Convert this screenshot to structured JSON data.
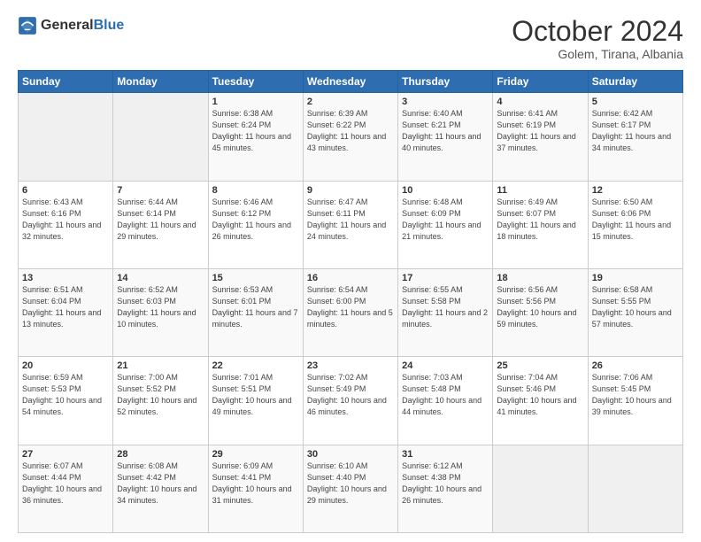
{
  "header": {
    "logo_general": "General",
    "logo_blue": "Blue",
    "month_year": "October 2024",
    "location": "Golem, Tirana, Albania"
  },
  "weekdays": [
    "Sunday",
    "Monday",
    "Tuesday",
    "Wednesday",
    "Thursday",
    "Friday",
    "Saturday"
  ],
  "weeks": [
    [
      {
        "day": "",
        "info": ""
      },
      {
        "day": "",
        "info": ""
      },
      {
        "day": "1",
        "info": "Sunrise: 6:38 AM\nSunset: 6:24 PM\nDaylight: 11 hours and 45 minutes."
      },
      {
        "day": "2",
        "info": "Sunrise: 6:39 AM\nSunset: 6:22 PM\nDaylight: 11 hours and 43 minutes."
      },
      {
        "day": "3",
        "info": "Sunrise: 6:40 AM\nSunset: 6:21 PM\nDaylight: 11 hours and 40 minutes."
      },
      {
        "day": "4",
        "info": "Sunrise: 6:41 AM\nSunset: 6:19 PM\nDaylight: 11 hours and 37 minutes."
      },
      {
        "day": "5",
        "info": "Sunrise: 6:42 AM\nSunset: 6:17 PM\nDaylight: 11 hours and 34 minutes."
      }
    ],
    [
      {
        "day": "6",
        "info": "Sunrise: 6:43 AM\nSunset: 6:16 PM\nDaylight: 11 hours and 32 minutes."
      },
      {
        "day": "7",
        "info": "Sunrise: 6:44 AM\nSunset: 6:14 PM\nDaylight: 11 hours and 29 minutes."
      },
      {
        "day": "8",
        "info": "Sunrise: 6:46 AM\nSunset: 6:12 PM\nDaylight: 11 hours and 26 minutes."
      },
      {
        "day": "9",
        "info": "Sunrise: 6:47 AM\nSunset: 6:11 PM\nDaylight: 11 hours and 24 minutes."
      },
      {
        "day": "10",
        "info": "Sunrise: 6:48 AM\nSunset: 6:09 PM\nDaylight: 11 hours and 21 minutes."
      },
      {
        "day": "11",
        "info": "Sunrise: 6:49 AM\nSunset: 6:07 PM\nDaylight: 11 hours and 18 minutes."
      },
      {
        "day": "12",
        "info": "Sunrise: 6:50 AM\nSunset: 6:06 PM\nDaylight: 11 hours and 15 minutes."
      }
    ],
    [
      {
        "day": "13",
        "info": "Sunrise: 6:51 AM\nSunset: 6:04 PM\nDaylight: 11 hours and 13 minutes."
      },
      {
        "day": "14",
        "info": "Sunrise: 6:52 AM\nSunset: 6:03 PM\nDaylight: 11 hours and 10 minutes."
      },
      {
        "day": "15",
        "info": "Sunrise: 6:53 AM\nSunset: 6:01 PM\nDaylight: 11 hours and 7 minutes."
      },
      {
        "day": "16",
        "info": "Sunrise: 6:54 AM\nSunset: 6:00 PM\nDaylight: 11 hours and 5 minutes."
      },
      {
        "day": "17",
        "info": "Sunrise: 6:55 AM\nSunset: 5:58 PM\nDaylight: 11 hours and 2 minutes."
      },
      {
        "day": "18",
        "info": "Sunrise: 6:56 AM\nSunset: 5:56 PM\nDaylight: 10 hours and 59 minutes."
      },
      {
        "day": "19",
        "info": "Sunrise: 6:58 AM\nSunset: 5:55 PM\nDaylight: 10 hours and 57 minutes."
      }
    ],
    [
      {
        "day": "20",
        "info": "Sunrise: 6:59 AM\nSunset: 5:53 PM\nDaylight: 10 hours and 54 minutes."
      },
      {
        "day": "21",
        "info": "Sunrise: 7:00 AM\nSunset: 5:52 PM\nDaylight: 10 hours and 52 minutes."
      },
      {
        "day": "22",
        "info": "Sunrise: 7:01 AM\nSunset: 5:51 PM\nDaylight: 10 hours and 49 minutes."
      },
      {
        "day": "23",
        "info": "Sunrise: 7:02 AM\nSunset: 5:49 PM\nDaylight: 10 hours and 46 minutes."
      },
      {
        "day": "24",
        "info": "Sunrise: 7:03 AM\nSunset: 5:48 PM\nDaylight: 10 hours and 44 minutes."
      },
      {
        "day": "25",
        "info": "Sunrise: 7:04 AM\nSunset: 5:46 PM\nDaylight: 10 hours and 41 minutes."
      },
      {
        "day": "26",
        "info": "Sunrise: 7:06 AM\nSunset: 5:45 PM\nDaylight: 10 hours and 39 minutes."
      }
    ],
    [
      {
        "day": "27",
        "info": "Sunrise: 6:07 AM\nSunset: 4:44 PM\nDaylight: 10 hours and 36 minutes."
      },
      {
        "day": "28",
        "info": "Sunrise: 6:08 AM\nSunset: 4:42 PM\nDaylight: 10 hours and 34 minutes."
      },
      {
        "day": "29",
        "info": "Sunrise: 6:09 AM\nSunset: 4:41 PM\nDaylight: 10 hours and 31 minutes."
      },
      {
        "day": "30",
        "info": "Sunrise: 6:10 AM\nSunset: 4:40 PM\nDaylight: 10 hours and 29 minutes."
      },
      {
        "day": "31",
        "info": "Sunrise: 6:12 AM\nSunset: 4:38 PM\nDaylight: 10 hours and 26 minutes."
      },
      {
        "day": "",
        "info": ""
      },
      {
        "day": "",
        "info": ""
      }
    ]
  ]
}
